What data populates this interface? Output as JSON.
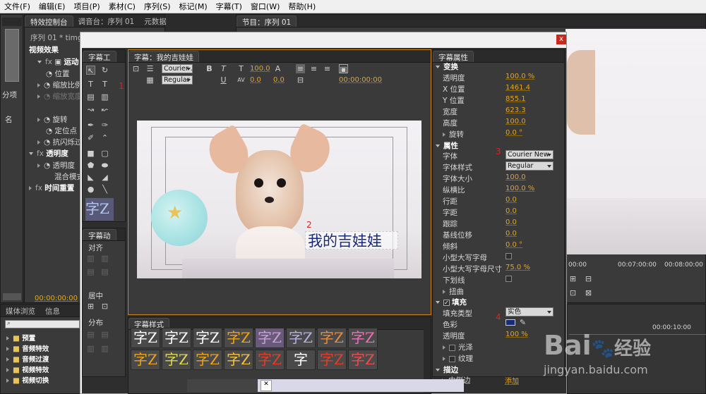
{
  "menu": [
    "文件(F)",
    "编辑(E)",
    "项目(P)",
    "素材(C)",
    "序列(S)",
    "标记(M)",
    "字幕(T)",
    "窗口(W)",
    "帮助(H)"
  ],
  "effect_controls": {
    "tabs": [
      "特效控制台",
      "调音台：序列 01",
      "元数据"
    ],
    "clip": "序列 01 * timg.pn",
    "header": "视频效果",
    "rows": [
      "运动",
      "位置",
      "缩放比例",
      "缩放宽度",
      "旋转",
      "定位点",
      "抗闪烁过",
      "透明度",
      "透明度",
      "混合模式",
      "时间重置"
    ],
    "timecode": "00:00:00:00"
  },
  "left_strip": {
    "label1": "分项",
    "label2": "名"
  },
  "program_monitor": {
    "tab": "节目：序列 01"
  },
  "project_panel": {
    "tabs": [
      "媒体浏览",
      "信息"
    ],
    "items": [
      "预置",
      "音频特效",
      "音频过渡",
      "视频特效",
      "视频切换"
    ]
  },
  "title_dialog": {
    "close": "x",
    "tools_tab": "字幕工",
    "actions_tab": "字幕动",
    "main_tab": "字幕：我的吉娃娃",
    "font_dd": "Courier ...",
    "style_dd": "Regular",
    "size": "100.0",
    "kerning": "0.0",
    "leading": "0.0",
    "timecode": "00:00:00:00",
    "caption": "我的吉娃娃",
    "actions": {
      "align": "对齐",
      "center": "居中",
      "distribute": "分布"
    },
    "styles_tab": "字幕样式",
    "style_glyph": "字Z",
    "style_glyph_plain": "字"
  },
  "annotations": [
    "1",
    "2",
    "3",
    "4"
  ],
  "title_properties": {
    "tab": "字幕属性",
    "transform": {
      "header": "变换",
      "rows": [
        {
          "label": "透明度",
          "value": "100.0 %"
        },
        {
          "label": "X 位置",
          "value": "1461.4"
        },
        {
          "label": "Y 位置",
          "value": "855.1"
        },
        {
          "label": "宽度",
          "value": "623.3"
        },
        {
          "label": "高度",
          "value": "100.0"
        },
        {
          "label": "旋转",
          "value": "0.0 °"
        }
      ]
    },
    "props": {
      "header": "属性",
      "font_label": "字体",
      "font_value": "Courier New",
      "style_label": "字体样式",
      "style_value": "Regular",
      "rows": [
        {
          "label": "字体大小",
          "value": "100.0"
        },
        {
          "label": "纵横比",
          "value": "100.0 %"
        },
        {
          "label": "行距",
          "value": "0.0"
        },
        {
          "label": "字距",
          "value": "0.0"
        },
        {
          "label": "跟踪",
          "value": "0.0"
        },
        {
          "label": "基线位移",
          "value": "0.0"
        },
        {
          "label": "倾斜",
          "value": "0.0 °"
        }
      ],
      "smallcaps": "小型大写字母",
      "smallcaps_size": "小型大写字母尺寸",
      "smallcaps_size_value": "75.0 %",
      "underline": "下划线",
      "distort": "扭曲"
    },
    "fill": {
      "header": "填充",
      "type_label": "填充类型",
      "type_value": "实色",
      "color_label": "色彩",
      "color_value": "#1a2a7a",
      "opacity_label": "透明度",
      "opacity_value": "100 %",
      "sheen": "光泽",
      "texture": "纹理"
    },
    "stroke": {
      "header": "描边",
      "inner": "内侧边",
      "add": "添加"
    }
  },
  "timeline": {
    "times": [
      "00:00",
      "00:07:00:00",
      "00:08:00:00"
    ],
    "times2": "00:00:10:00"
  },
  "watermark": {
    "brand": "Bai",
    "brand2": "经验",
    "url": "jingyan.baidu.com"
  },
  "colors": {
    "accent": "#e3a51e",
    "panel": "#3a3a3a",
    "caption": "#1a2a7a"
  }
}
